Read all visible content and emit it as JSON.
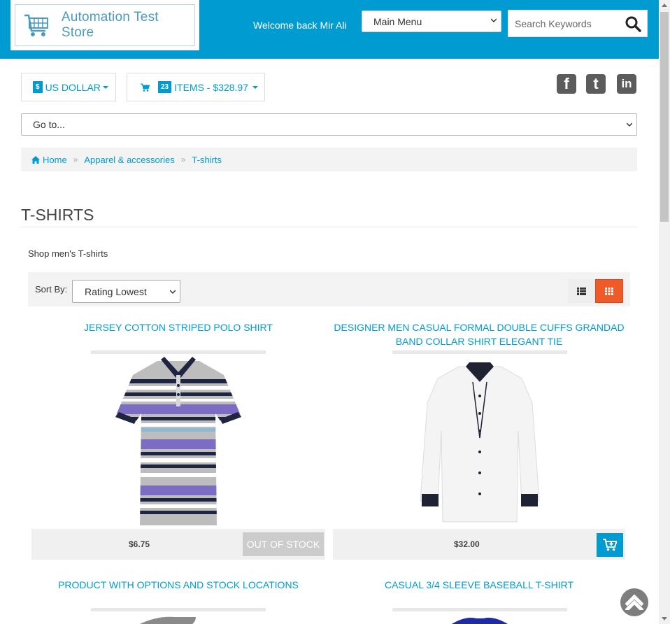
{
  "header": {
    "logo_text": "Automation Test Store",
    "welcome": "Welcome back Mir Ali",
    "main_menu_selected": "Main Menu",
    "search_placeholder": "Search Keywords"
  },
  "currency": {
    "symbol": "$",
    "label": "US DOLLAR"
  },
  "cart": {
    "count": "23",
    "label": "ITEMS - $328.97"
  },
  "social": [
    "facebook-icon",
    "twitter-icon",
    "linkedin-icon"
  ],
  "goto_select": "Go to...",
  "breadcrumb": [
    {
      "label": "Home",
      "icon": "home-icon"
    },
    {
      "label": "Apparel & accessories"
    },
    {
      "label": "T-shirts"
    }
  ],
  "page": {
    "title": "T-SHIRTS",
    "description": "Shop men's T-shirts"
  },
  "sort": {
    "label": "Sort By:",
    "selected": "Rating Lowest"
  },
  "products": [
    {
      "name": "JERSEY COTTON STRIPED POLO SHIRT",
      "price": "$6.75",
      "status": "OUT OF STOCK"
    },
    {
      "name": "DESIGNER MEN CASUAL FORMAL DOUBLE CUFFS GRANDAD BAND COLLAR SHIRT ELEGANT TIE",
      "price": "$32.00",
      "status": "add-to-cart"
    },
    {
      "name": "PRODUCT WITH OPTIONS AND STOCK LOCATIONS"
    },
    {
      "name": "CASUAL 3/4 SLEEVE BASEBALL T-SHIRT"
    }
  ],
  "colors": {
    "brand": "#009cd1",
    "active_view": "#f05a28"
  }
}
